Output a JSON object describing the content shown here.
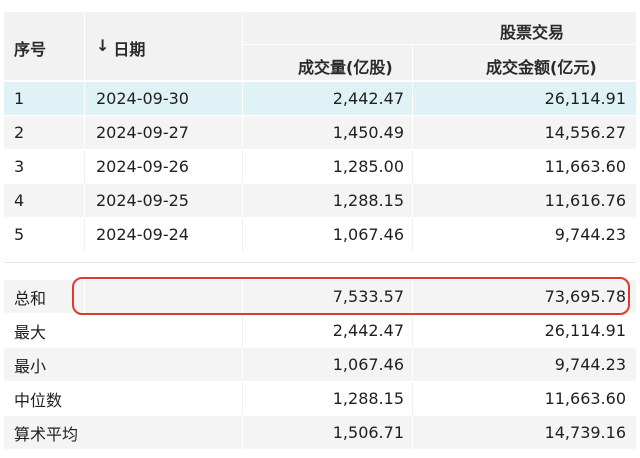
{
  "header": {
    "idx": "序号",
    "date_arrow": "↓",
    "date": "日期",
    "group": "股票交易",
    "vol": "成交量(亿股)",
    "amt": "成交金额(亿元)"
  },
  "rows": [
    {
      "idx": "1",
      "date": "2024-09-30",
      "vol": "2,442.47",
      "amt": "26,114.91"
    },
    {
      "idx": "2",
      "date": "2024-09-27",
      "vol": "1,450.49",
      "amt": "14,556.27"
    },
    {
      "idx": "3",
      "date": "2024-09-26",
      "vol": "1,285.00",
      "amt": "11,663.60"
    },
    {
      "idx": "4",
      "date": "2024-09-25",
      "vol": "1,288.15",
      "amt": "11,616.76"
    },
    {
      "idx": "5",
      "date": "2024-09-24",
      "vol": "1,067.46",
      "amt": "9,744.23"
    }
  ],
  "summary": [
    {
      "label": "总和",
      "vol": "7,533.57",
      "amt": "73,695.78"
    },
    {
      "label": "最大",
      "vol": "2,442.47",
      "amt": "26,114.91"
    },
    {
      "label": "最小",
      "vol": "1,067.46",
      "amt": "9,744.23"
    },
    {
      "label": "中位数",
      "vol": "1,288.15",
      "amt": "11,663.60"
    },
    {
      "label": "算术平均",
      "vol": "1,506.71",
      "amt": "14,739.16"
    }
  ],
  "colors": {
    "header_bg": "#f2f2f2",
    "row_selected": "#dff3f7",
    "row_even": "#f4f4f4",
    "row_odd": "#ffffff",
    "highlight_border": "#e03a2f"
  }
}
